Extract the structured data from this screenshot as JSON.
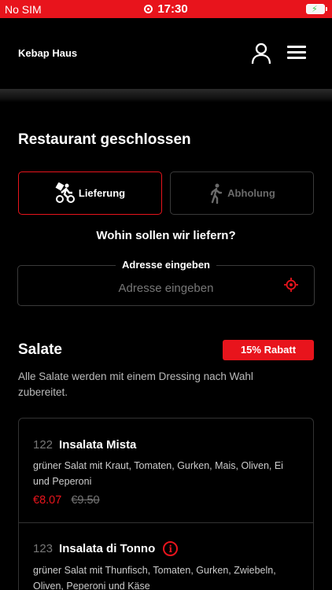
{
  "status_bar": {
    "carrier": "No SIM",
    "time": "17:30"
  },
  "header": {
    "brand": "Kebap Haus"
  },
  "status": {
    "title": "Restaurant geschlossen"
  },
  "modes": {
    "delivery_label": "Lieferung",
    "pickup_label": "Abholung",
    "selected": "Lieferung"
  },
  "address": {
    "question": "Wohin sollen wir liefern?",
    "legend": "Adresse eingeben",
    "placeholder": "Adresse eingeben",
    "value": ""
  },
  "category": {
    "title": "Salate",
    "discount_badge": "15% Rabatt",
    "description": "Alle Salate werden mit einem Dressing nach Wahl zubereitet.",
    "items": [
      {
        "number": "122",
        "name": "Insalata Mista",
        "description": "grüner Salat mit Kraut, Tomaten, Gurken, Mais, Oliven, Ei und Peperoni",
        "price_discounted": "€8.07",
        "price_original": "€9.50"
      },
      {
        "number": "123",
        "name": "Insalata di Tonno",
        "description": "grüner Salat mit Thunfisch, Tomaten, Gurken, Zwiebeln, Oliven, Peperoni und Käse",
        "info_icon": "i"
      }
    ]
  },
  "colors": {
    "accent": "#e8141c",
    "background": "#000000"
  }
}
